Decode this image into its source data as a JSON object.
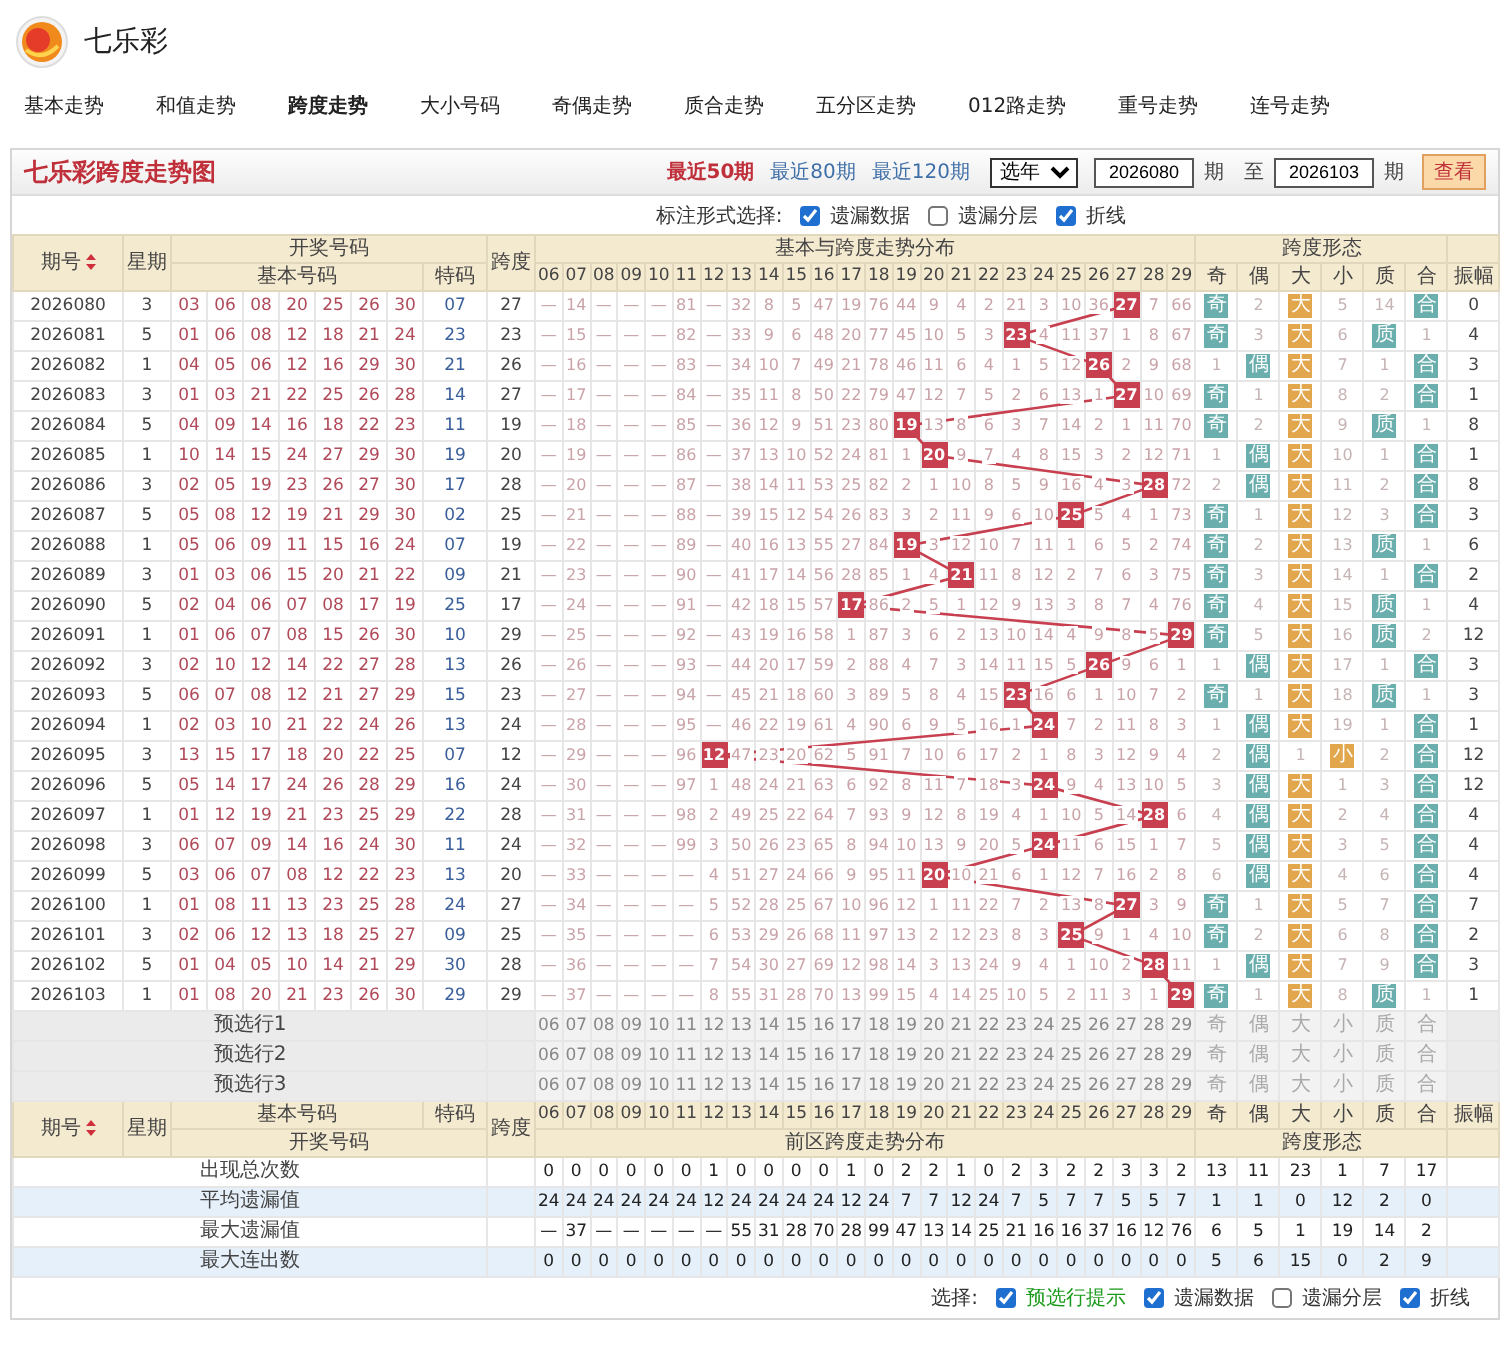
{
  "site": {
    "name": "七乐彩"
  },
  "nav": [
    {
      "label": "基本走势",
      "selected": false
    },
    {
      "label": "和值走势",
      "selected": false
    },
    {
      "label": "跨度走势",
      "selected": true
    },
    {
      "label": "大小号码",
      "selected": false
    },
    {
      "label": "奇偶走势",
      "selected": false
    },
    {
      "label": "质合走势",
      "selected": false
    },
    {
      "label": "五分区走势",
      "selected": false
    },
    {
      "label": "012路走势",
      "selected": false
    },
    {
      "label": "重号走势",
      "selected": false
    },
    {
      "label": "连号走势",
      "selected": false
    }
  ],
  "chart": {
    "title": "七乐彩跨度走势图",
    "ranges": [
      {
        "label": "最近50期",
        "selected": true
      },
      {
        "label": "最近80期",
        "selected": false
      },
      {
        "label": "最近120期",
        "selected": false
      }
    ],
    "year_select": "选年",
    "from": "2026080",
    "from_unit": "期",
    "to_word": "至",
    "to": "2026103",
    "to_unit": "期",
    "view_button": "查看"
  },
  "options": {
    "label": "标注形式选择:",
    "items": [
      {
        "label": "遗漏数据",
        "checked": true
      },
      {
        "label": "遗漏分层",
        "checked": false
      },
      {
        "label": "折线",
        "checked": true
      }
    ]
  },
  "header": {
    "issue": "期号",
    "weekday": "星期",
    "draw": "开奖号码",
    "span": "跨度",
    "distribution": "基本与跨度走势分布",
    "form": "跨度形态",
    "basic": "基本号码",
    "special": "特码",
    "amplitude": "振幅",
    "numbers": [
      "06",
      "07",
      "08",
      "09",
      "10",
      "11",
      "12",
      "13",
      "14",
      "15",
      "16",
      "17",
      "18",
      "19",
      "20",
      "21",
      "22",
      "23",
      "24",
      "25",
      "26",
      "27",
      "28",
      "29"
    ],
    "form_labels": [
      "奇",
      "偶",
      "大",
      "小",
      "质",
      "合"
    ]
  },
  "rows": [
    {
      "issue": "2026080",
      "weekday": "3",
      "basic": [
        "03",
        "06",
        "08",
        "20",
        "25",
        "26",
        "30"
      ],
      "special": "07",
      "span": "27",
      "dist": [
        "—",
        "14",
        "—",
        "—",
        "—",
        "81",
        "—",
        "32",
        "8",
        "5",
        "47",
        "19",
        "76",
        "44",
        "9",
        "4",
        "2",
        "21",
        "3",
        "10",
        "36",
        {
          "text": "27",
          "hit": true
        },
        "7",
        "66"
      ],
      "form": [
        {
          "text": "奇",
          "hit": true
        },
        "2",
        {
          "text": "大",
          "hit": true
        },
        "5",
        "14",
        {
          "text": "合",
          "hit": true
        }
      ],
      "amplitude": "0"
    },
    {
      "issue": "2026081",
      "weekday": "5",
      "basic": [
        "01",
        "06",
        "08",
        "12",
        "18",
        "21",
        "24"
      ],
      "special": "23",
      "span": "23",
      "dist": [
        "—",
        "15",
        "—",
        "—",
        "—",
        "82",
        "—",
        "33",
        "9",
        "6",
        "48",
        "20",
        "77",
        "45",
        "10",
        "5",
        "3",
        {
          "text": "23",
          "hit": true
        },
        "4",
        "11",
        "37",
        "1",
        "8",
        "67"
      ],
      "form": [
        {
          "text": "奇",
          "hit": true
        },
        "3",
        {
          "text": "大",
          "hit": true
        },
        "6",
        {
          "text": "质",
          "hit": true
        },
        "1"
      ],
      "amplitude": "4"
    },
    {
      "issue": "2026082",
      "weekday": "1",
      "basic": [
        "04",
        "05",
        "06",
        "12",
        "16",
        "29",
        "30"
      ],
      "special": "21",
      "span": "26",
      "dist": [
        "—",
        "16",
        "—",
        "—",
        "—",
        "83",
        "—",
        "34",
        "10",
        "7",
        "49",
        "21",
        "78",
        "46",
        "11",
        "6",
        "4",
        "1",
        "5",
        "12",
        {
          "text": "26",
          "hit": true
        },
        "2",
        "9",
        "68"
      ],
      "form": [
        "1",
        {
          "text": "偶",
          "hit": true
        },
        {
          "text": "大",
          "hit": true
        },
        "7",
        "1",
        {
          "text": "合",
          "hit": true
        }
      ],
      "amplitude": "3"
    },
    {
      "issue": "2026083",
      "weekday": "3",
      "basic": [
        "01",
        "03",
        "21",
        "22",
        "25",
        "26",
        "28"
      ],
      "special": "14",
      "span": "27",
      "dist": [
        "—",
        "17",
        "—",
        "—",
        "—",
        "84",
        "—",
        "35",
        "11",
        "8",
        "50",
        "22",
        "79",
        "47",
        "12",
        "7",
        "5",
        "2",
        "6",
        "13",
        "1",
        {
          "text": "27",
          "hit": true
        },
        "10",
        "69"
      ],
      "form": [
        {
          "text": "奇",
          "hit": true
        },
        "1",
        {
          "text": "大",
          "hit": true
        },
        "8",
        "2",
        {
          "text": "合",
          "hit": true
        }
      ],
      "amplitude": "1"
    },
    {
      "issue": "2026084",
      "weekday": "5",
      "basic": [
        "04",
        "09",
        "14",
        "16",
        "18",
        "22",
        "23"
      ],
      "special": "11",
      "span": "19",
      "dist": [
        "—",
        "18",
        "—",
        "—",
        "—",
        "85",
        "—",
        "36",
        "12",
        "9",
        "51",
        "23",
        "80",
        {
          "text": "19",
          "hit": true
        },
        "13",
        "8",
        "6",
        "3",
        "7",
        "14",
        "2",
        "1",
        "11",
        "70"
      ],
      "form": [
        {
          "text": "奇",
          "hit": true
        },
        "2",
        {
          "text": "大",
          "hit": true
        },
        "9",
        {
          "text": "质",
          "hit": true
        },
        "1"
      ],
      "amplitude": "8"
    },
    {
      "issue": "2026085",
      "weekday": "1",
      "basic": [
        "10",
        "14",
        "15",
        "24",
        "27",
        "29",
        "30"
      ],
      "special": "19",
      "span": "20",
      "dist": [
        "—",
        "19",
        "—",
        "—",
        "—",
        "86",
        "—",
        "37",
        "13",
        "10",
        "52",
        "24",
        "81",
        "1",
        {
          "text": "20",
          "hit": true
        },
        "9",
        "7",
        "4",
        "8",
        "15",
        "3",
        "2",
        "12",
        "71"
      ],
      "form": [
        "1",
        {
          "text": "偶",
          "hit": true
        },
        {
          "text": "大",
          "hit": true
        },
        "10",
        "1",
        {
          "text": "合",
          "hit": true
        }
      ],
      "amplitude": "1"
    },
    {
      "issue": "2026086",
      "weekday": "3",
      "basic": [
        "02",
        "05",
        "19",
        "23",
        "26",
        "27",
        "30"
      ],
      "special": "17",
      "span": "28",
      "dist": [
        "—",
        "20",
        "—",
        "—",
        "—",
        "87",
        "—",
        "38",
        "14",
        "11",
        "53",
        "25",
        "82",
        "2",
        "1",
        "10",
        "8",
        "5",
        "9",
        "16",
        "4",
        "3",
        {
          "text": "28",
          "hit": true
        },
        "72"
      ],
      "form": [
        "2",
        {
          "text": "偶",
          "hit": true
        },
        {
          "text": "大",
          "hit": true
        },
        "11",
        "2",
        {
          "text": "合",
          "hit": true
        }
      ],
      "amplitude": "8"
    },
    {
      "issue": "2026087",
      "weekday": "5",
      "basic": [
        "05",
        "08",
        "12",
        "19",
        "21",
        "29",
        "30"
      ],
      "special": "02",
      "span": "25",
      "dist": [
        "—",
        "21",
        "—",
        "—",
        "—",
        "88",
        "—",
        "39",
        "15",
        "12",
        "54",
        "26",
        "83",
        "3",
        "2",
        "11",
        "9",
        "6",
        "10",
        {
          "text": "25",
          "hit": true
        },
        "5",
        "4",
        "1",
        "73"
      ],
      "form": [
        {
          "text": "奇",
          "hit": true
        },
        "1",
        {
          "text": "大",
          "hit": true
        },
        "12",
        "3",
        {
          "text": "合",
          "hit": true
        }
      ],
      "amplitude": "3"
    },
    {
      "issue": "2026088",
      "weekday": "1",
      "basic": [
        "05",
        "06",
        "09",
        "11",
        "15",
        "16",
        "24"
      ],
      "special": "07",
      "span": "19",
      "dist": [
        "—",
        "22",
        "—",
        "—",
        "—",
        "89",
        "—",
        "40",
        "16",
        "13",
        "55",
        "27",
        "84",
        {
          "text": "19",
          "hit": true
        },
        "3",
        "12",
        "10",
        "7",
        "11",
        "1",
        "6",
        "5",
        "2",
        "74"
      ],
      "form": [
        {
          "text": "奇",
          "hit": true
        },
        "2",
        {
          "text": "大",
          "hit": true
        },
        "13",
        {
          "text": "质",
          "hit": true
        },
        "1"
      ],
      "amplitude": "6"
    },
    {
      "issue": "2026089",
      "weekday": "3",
      "basic": [
        "01",
        "03",
        "06",
        "15",
        "20",
        "21",
        "22"
      ],
      "special": "09",
      "span": "21",
      "dist": [
        "—",
        "23",
        "—",
        "—",
        "—",
        "90",
        "—",
        "41",
        "17",
        "14",
        "56",
        "28",
        "85",
        "1",
        "4",
        {
          "text": "21",
          "hit": true
        },
        "11",
        "8",
        "12",
        "2",
        "7",
        "6",
        "3",
        "75"
      ],
      "form": [
        {
          "text": "奇",
          "hit": true
        },
        "3",
        {
          "text": "大",
          "hit": true
        },
        "14",
        "1",
        {
          "text": "合",
          "hit": true
        }
      ],
      "amplitude": "2"
    },
    {
      "issue": "2026090",
      "weekday": "5",
      "basic": [
        "02",
        "04",
        "06",
        "07",
        "08",
        "17",
        "19"
      ],
      "special": "25",
      "span": "17",
      "dist": [
        "—",
        "24",
        "—",
        "—",
        "—",
        "91",
        "—",
        "42",
        "18",
        "15",
        "57",
        {
          "text": "17",
          "hit": true
        },
        "86",
        "2",
        "5",
        "1",
        "12",
        "9",
        "13",
        "3",
        "8",
        "7",
        "4",
        "76"
      ],
      "form": [
        {
          "text": "奇",
          "hit": true
        },
        "4",
        {
          "text": "大",
          "hit": true
        },
        "15",
        {
          "text": "质",
          "hit": true
        },
        "1"
      ],
      "amplitude": "4"
    },
    {
      "issue": "2026091",
      "weekday": "1",
      "basic": [
        "01",
        "06",
        "07",
        "08",
        "15",
        "26",
        "30"
      ],
      "special": "10",
      "span": "29",
      "dist": [
        "—",
        "25",
        "—",
        "—",
        "—",
        "92",
        "—",
        "43",
        "19",
        "16",
        "58",
        "1",
        "87",
        "3",
        "6",
        "2",
        "13",
        "10",
        "14",
        "4",
        "9",
        "8",
        "5",
        {
          "text": "29",
          "hit": true
        }
      ],
      "form": [
        {
          "text": "奇",
          "hit": true
        },
        "5",
        {
          "text": "大",
          "hit": true
        },
        "16",
        {
          "text": "质",
          "hit": true
        },
        "2"
      ],
      "amplitude": "12"
    },
    {
      "issue": "2026092",
      "weekday": "3",
      "basic": [
        "02",
        "10",
        "12",
        "14",
        "22",
        "27",
        "28"
      ],
      "special": "13",
      "span": "26",
      "dist": [
        "—",
        "26",
        "—",
        "—",
        "—",
        "93",
        "—",
        "44",
        "20",
        "17",
        "59",
        "2",
        "88",
        "4",
        "7",
        "3",
        "14",
        "11",
        "15",
        "5",
        {
          "text": "26",
          "hit": true
        },
        "9",
        "6",
        "1"
      ],
      "form": [
        "1",
        {
          "text": "偶",
          "hit": true
        },
        {
          "text": "大",
          "hit": true
        },
        "17",
        "1",
        {
          "text": "合",
          "hit": true
        }
      ],
      "amplitude": "3"
    },
    {
      "issue": "2026093",
      "weekday": "5",
      "basic": [
        "06",
        "07",
        "08",
        "12",
        "21",
        "27",
        "29"
      ],
      "special": "15",
      "span": "23",
      "dist": [
        "—",
        "27",
        "—",
        "—",
        "—",
        "94",
        "—",
        "45",
        "21",
        "18",
        "60",
        "3",
        "89",
        "5",
        "8",
        "4",
        "15",
        {
          "text": "23",
          "hit": true
        },
        "16",
        "6",
        "1",
        "10",
        "7",
        "2"
      ],
      "form": [
        {
          "text": "奇",
          "hit": true
        },
        "1",
        {
          "text": "大",
          "hit": true
        },
        "18",
        {
          "text": "质",
          "hit": true
        },
        "1"
      ],
      "amplitude": "3"
    },
    {
      "issue": "2026094",
      "weekday": "1",
      "basic": [
        "02",
        "03",
        "10",
        "21",
        "22",
        "24",
        "26"
      ],
      "special": "13",
      "span": "24",
      "dist": [
        "—",
        "28",
        "—",
        "—",
        "—",
        "95",
        "—",
        "46",
        "22",
        "19",
        "61",
        "4",
        "90",
        "6",
        "9",
        "5",
        "16",
        "1",
        {
          "text": "24",
          "hit": true
        },
        "7",
        "2",
        "11",
        "8",
        "3"
      ],
      "form": [
        "1",
        {
          "text": "偶",
          "hit": true
        },
        {
          "text": "大",
          "hit": true
        },
        "19",
        "1",
        {
          "text": "合",
          "hit": true
        }
      ],
      "amplitude": "1"
    },
    {
      "issue": "2026095",
      "weekday": "3",
      "basic": [
        "13",
        "15",
        "17",
        "18",
        "20",
        "22",
        "25"
      ],
      "special": "07",
      "span": "12",
      "dist": [
        "—",
        "29",
        "—",
        "—",
        "—",
        "96",
        {
          "text": "12",
          "hit": true
        },
        "47",
        "23",
        "20",
        "62",
        "5",
        "91",
        "7",
        "10",
        "6",
        "17",
        "2",
        "1",
        "8",
        "3",
        "12",
        "9",
        "4"
      ],
      "form": [
        "2",
        {
          "text": "偶",
          "hit": true
        },
        "1",
        {
          "text": "小",
          "hit": true
        },
        "2",
        {
          "text": "合",
          "hit": true
        }
      ],
      "amplitude": "12"
    },
    {
      "issue": "2026096",
      "weekday": "5",
      "basic": [
        "05",
        "14",
        "17",
        "24",
        "26",
        "28",
        "29"
      ],
      "special": "16",
      "span": "24",
      "dist": [
        "—",
        "30",
        "—",
        "—",
        "—",
        "97",
        "1",
        "48",
        "24",
        "21",
        "63",
        "6",
        "92",
        "8",
        "11",
        "7",
        "18",
        "3",
        {
          "text": "24",
          "hit": true
        },
        "9",
        "4",
        "13",
        "10",
        "5"
      ],
      "form": [
        "3",
        {
          "text": "偶",
          "hit": true
        },
        {
          "text": "大",
          "hit": true
        },
        "1",
        "3",
        {
          "text": "合",
          "hit": true
        }
      ],
      "amplitude": "12"
    },
    {
      "issue": "2026097",
      "weekday": "1",
      "basic": [
        "01",
        "12",
        "19",
        "21",
        "23",
        "25",
        "29"
      ],
      "special": "22",
      "span": "28",
      "dist": [
        "—",
        "31",
        "—",
        "—",
        "—",
        "98",
        "2",
        "49",
        "25",
        "22",
        "64",
        "7",
        "93",
        "9",
        "12",
        "8",
        "19",
        "4",
        "1",
        "10",
        "5",
        "14",
        {
          "text": "28",
          "hit": true
        },
        "6"
      ],
      "form": [
        "4",
        {
          "text": "偶",
          "hit": true
        },
        {
          "text": "大",
          "hit": true
        },
        "2",
        "4",
        {
          "text": "合",
          "hit": true
        }
      ],
      "amplitude": "4"
    },
    {
      "issue": "2026098",
      "weekday": "3",
      "basic": [
        "06",
        "07",
        "09",
        "14",
        "16",
        "24",
        "30"
      ],
      "special": "11",
      "span": "24",
      "dist": [
        "—",
        "32",
        "—",
        "—",
        "—",
        "99",
        "3",
        "50",
        "26",
        "23",
        "65",
        "8",
        "94",
        "10",
        "13",
        "9",
        "20",
        "5",
        {
          "text": "24",
          "hit": true
        },
        "11",
        "6",
        "15",
        "1",
        "7"
      ],
      "form": [
        "5",
        {
          "text": "偶",
          "hit": true
        },
        {
          "text": "大",
          "hit": true
        },
        "3",
        "5",
        {
          "text": "合",
          "hit": true
        }
      ],
      "amplitude": "4"
    },
    {
      "issue": "2026099",
      "weekday": "5",
      "basic": [
        "03",
        "06",
        "07",
        "08",
        "12",
        "22",
        "23"
      ],
      "special": "13",
      "span": "20",
      "dist": [
        "—",
        "33",
        "—",
        "—",
        "—",
        "—",
        "4",
        "51",
        "27",
        "24",
        "66",
        "9",
        "95",
        "11",
        {
          "text": "20",
          "hit": true
        },
        "10",
        "21",
        "6",
        "1",
        "12",
        "7",
        "16",
        "2",
        "8"
      ],
      "form": [
        "6",
        {
          "text": "偶",
          "hit": true
        },
        {
          "text": "大",
          "hit": true
        },
        "4",
        "6",
        {
          "text": "合",
          "hit": true
        }
      ],
      "amplitude": "4"
    },
    {
      "issue": "2026100",
      "weekday": "1",
      "basic": [
        "01",
        "08",
        "11",
        "13",
        "23",
        "25",
        "28"
      ],
      "special": "24",
      "span": "27",
      "dist": [
        "—",
        "34",
        "—",
        "—",
        "—",
        "—",
        "5",
        "52",
        "28",
        "25",
        "67",
        "10",
        "96",
        "12",
        "1",
        "11",
        "22",
        "7",
        "2",
        "13",
        "8",
        {
          "text": "27",
          "hit": true
        },
        "3",
        "9"
      ],
      "form": [
        {
          "text": "奇",
          "hit": true
        },
        "1",
        {
          "text": "大",
          "hit": true
        },
        "5",
        "7",
        {
          "text": "合",
          "hit": true
        }
      ],
      "amplitude": "7"
    },
    {
      "issue": "2026101",
      "weekday": "3",
      "basic": [
        "02",
        "06",
        "12",
        "13",
        "18",
        "25",
        "27"
      ],
      "special": "09",
      "span": "25",
      "dist": [
        "—",
        "35",
        "—",
        "—",
        "—",
        "—",
        "6",
        "53",
        "29",
        "26",
        "68",
        "11",
        "97",
        "13",
        "2",
        "12",
        "23",
        "8",
        "3",
        {
          "text": "25",
          "hit": true
        },
        "9",
        "1",
        "4",
        "10"
      ],
      "form": [
        {
          "text": "奇",
          "hit": true
        },
        "2",
        {
          "text": "大",
          "hit": true
        },
        "6",
        "8",
        {
          "text": "合",
          "hit": true
        }
      ],
      "amplitude": "2"
    },
    {
      "issue": "2026102",
      "weekday": "5",
      "basic": [
        "01",
        "04",
        "05",
        "10",
        "14",
        "21",
        "29"
      ],
      "special": "30",
      "span": "28",
      "dist": [
        "—",
        "36",
        "—",
        "—",
        "—",
        "—",
        "7",
        "54",
        "30",
        "27",
        "69",
        "12",
        "98",
        "14",
        "3",
        "13",
        "24",
        "9",
        "4",
        "1",
        "10",
        "2",
        {
          "text": "28",
          "hit": true
        },
        "11"
      ],
      "form": [
        "1",
        {
          "text": "偶",
          "hit": true
        },
        {
          "text": "大",
          "hit": true
        },
        "7",
        "9",
        {
          "text": "合",
          "hit": true
        }
      ],
      "amplitude": "3"
    },
    {
      "issue": "2026103",
      "weekday": "1",
      "basic": [
        "01",
        "08",
        "20",
        "21",
        "23",
        "26",
        "30"
      ],
      "special": "29",
      "span": "29",
      "dist": [
        "—",
        "37",
        "—",
        "—",
        "—",
        "—",
        "8",
        "55",
        "31",
        "28",
        "70",
        "13",
        "99",
        "15",
        "4",
        "14",
        "25",
        "10",
        "5",
        "2",
        "11",
        "3",
        "1",
        {
          "text": "29",
          "hit": true
        }
      ],
      "form": [
        {
          "text": "奇",
          "hit": true
        },
        "1",
        {
          "text": "大",
          "hit": true
        },
        "8",
        {
          "text": "质",
          "hit": true
        },
        "1"
      ],
      "amplitude": "1"
    }
  ],
  "preselect_rows": [
    {
      "label": "预选行1",
      "numbers": [
        "06",
        "07",
        "08",
        "09",
        "10",
        "11",
        "12",
        "13",
        "14",
        "15",
        "16",
        "17",
        "18",
        "19",
        "20",
        "21",
        "22",
        "23",
        "24",
        "25",
        "26",
        "27",
        "28",
        "29"
      ],
      "form": [
        "奇",
        "偶",
        "大",
        "小",
        "质",
        "合"
      ]
    },
    {
      "label": "预选行2",
      "numbers": [
        "06",
        "07",
        "08",
        "09",
        "10",
        "11",
        "12",
        "13",
        "14",
        "15",
        "16",
        "17",
        "18",
        "19",
        "20",
        "21",
        "22",
        "23",
        "24",
        "25",
        "26",
        "27",
        "28",
        "29"
      ],
      "form": [
        "奇",
        "偶",
        "大",
        "小",
        "质",
        "合"
      ]
    },
    {
      "label": "预选行3",
      "numbers": [
        "06",
        "07",
        "08",
        "09",
        "10",
        "11",
        "12",
        "13",
        "14",
        "15",
        "16",
        "17",
        "18",
        "19",
        "20",
        "21",
        "22",
        "23",
        "24",
        "25",
        "26",
        "27",
        "28",
        "29"
      ],
      "form": [
        "奇",
        "偶",
        "大",
        "小",
        "质",
        "合"
      ]
    }
  ],
  "footer_header": {
    "issue": "期号",
    "weekday": "星期",
    "basic": "基本号码",
    "special": "特码",
    "span": "跨度",
    "amplitude": "振幅",
    "draw": "开奖号码",
    "distribution": "前区跨度走势分布",
    "form": "跨度形态",
    "numbers": [
      "06",
      "07",
      "08",
      "09",
      "10",
      "11",
      "12",
      "13",
      "14",
      "15",
      "16",
      "17",
      "18",
      "19",
      "20",
      "21",
      "22",
      "23",
      "24",
      "25",
      "26",
      "27",
      "28",
      "29"
    ],
    "form_labels": [
      "奇",
      "偶",
      "大",
      "小",
      "质",
      "合"
    ]
  },
  "stats": [
    {
      "label": "出现总次数",
      "numbers": [
        "0",
        "0",
        "0",
        "0",
        "0",
        "0",
        "1",
        "0",
        "0",
        "0",
        "0",
        "1",
        "0",
        "2",
        "2",
        "1",
        "0",
        "2",
        "3",
        "2",
        "2",
        "3",
        "3",
        "2"
      ],
      "form": [
        "13",
        "11",
        "23",
        "1",
        "7",
        "17"
      ]
    },
    {
      "label": "平均遗漏值",
      "numbers": [
        "24",
        "24",
        "24",
        "24",
        "24",
        "24",
        "12",
        "24",
        "24",
        "24",
        "24",
        "12",
        "24",
        "7",
        "7",
        "12",
        "24",
        "7",
        "5",
        "7",
        "7",
        "5",
        "5",
        "7"
      ],
      "form": [
        "1",
        "1",
        "0",
        "12",
        "2",
        "0"
      ]
    },
    {
      "label": "最大遗漏值",
      "numbers": [
        "—",
        "37",
        "—",
        "—",
        "—",
        "—",
        "—",
        "55",
        "31",
        "28",
        "70",
        "28",
        "99",
        "47",
        "13",
        "14",
        "25",
        "21",
        "16",
        "16",
        "37",
        "16",
        "12",
        "76"
      ],
      "form": [
        "6",
        "5",
        "1",
        "19",
        "14",
        "2"
      ]
    },
    {
      "label": "最大连出数",
      "numbers": [
        "0",
        "0",
        "0",
        "0",
        "0",
        "0",
        "0",
        "0",
        "0",
        "0",
        "0",
        "0",
        "0",
        "0",
        "0",
        "0",
        "0",
        "0",
        "0",
        "0",
        "0",
        "0",
        "0",
        "0"
      ],
      "form": [
        "5",
        "6",
        "15",
        "0",
        "2",
        "9"
      ]
    }
  ],
  "footer": {
    "label": "选择:",
    "items": [
      {
        "label": "预选行提示",
        "checked": true
      },
      {
        "label": "遗漏数据",
        "checked": true
      },
      {
        "label": "遗漏分层",
        "checked": false
      },
      {
        "label": "折线",
        "checked": true
      }
    ]
  }
}
